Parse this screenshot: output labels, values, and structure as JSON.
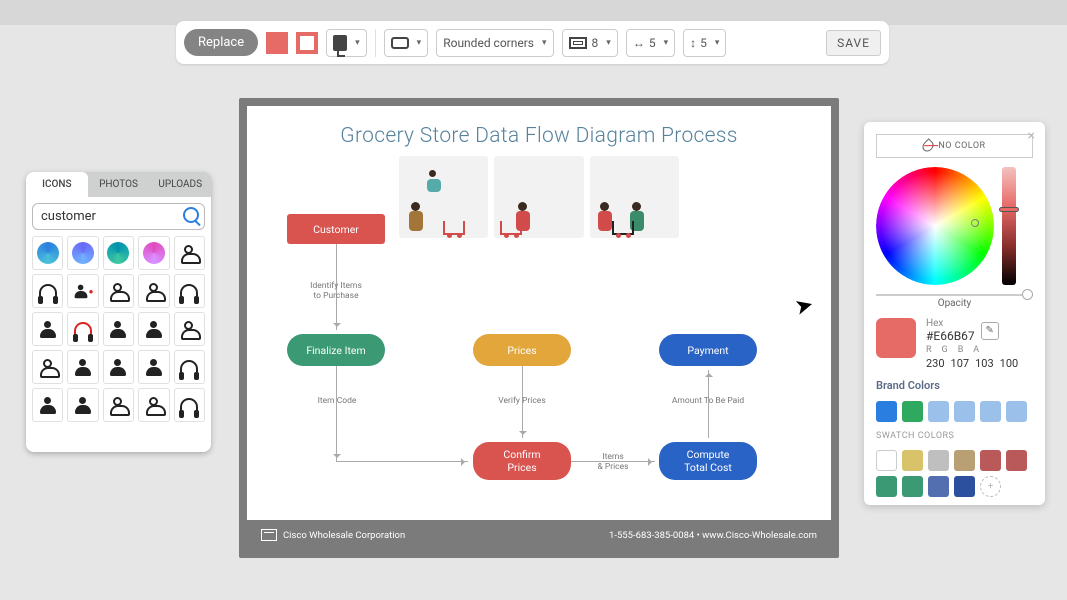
{
  "toolbar": {
    "replace": "Replace",
    "fill_color": "#e66b67",
    "stroke_color": "#e66b67",
    "corners_label": "Rounded corners",
    "border_weight": "8",
    "arrow_h": "5",
    "arrow_v": "5",
    "save": "SAVE"
  },
  "icon_panel": {
    "tabs": [
      "ICONS",
      "PHOTOS",
      "UPLOADS"
    ],
    "active_tab": 0,
    "search_value": "customer"
  },
  "canvas": {
    "title": "Grocery Store Data Flow Diagram Process",
    "nodes": {
      "customer": "Customer",
      "finalize": "Finalize Item",
      "prices": "Prices",
      "payment": "Payment",
      "confirm": "Confirm\nPrices",
      "compute": "Compute\nTotal Cost"
    },
    "edges": {
      "identify": "Identify Items\nto Purchase",
      "item_code": "Item Code",
      "verify": "Verify Prices",
      "items_prices": "Items\n& Prices",
      "amount": "Amount To Be Paid"
    },
    "footer_company": "Cisco Wholesale Corporation",
    "footer_contact": "1-555-683-385-0084 • www.Cisco-Wholesale.com"
  },
  "color_panel": {
    "no_color": "NO COLOR",
    "opacity_label": "Opacity",
    "hex_label": "Hex",
    "hex_value": "#E66B67",
    "rgba_labels": [
      "R",
      "G",
      "B",
      "A"
    ],
    "rgba_values": [
      "230",
      "107",
      "103",
      "100"
    ],
    "brand_title": "Brand Colors",
    "brand_colors": [
      "#2a7ee0",
      "#2fa860",
      "#9bc1ea",
      "#9bc1ea",
      "#9bc1ea",
      "#9bc1ea"
    ],
    "swatch_title": "SWATCH COLORS",
    "swatch_colors": [
      "",
      "#d9c36a",
      "#bfbfbf",
      "#b9a074",
      "#b9595a",
      "#3b9a74",
      "#3b9a74",
      "#546faf",
      "#2c4f9e"
    ]
  }
}
